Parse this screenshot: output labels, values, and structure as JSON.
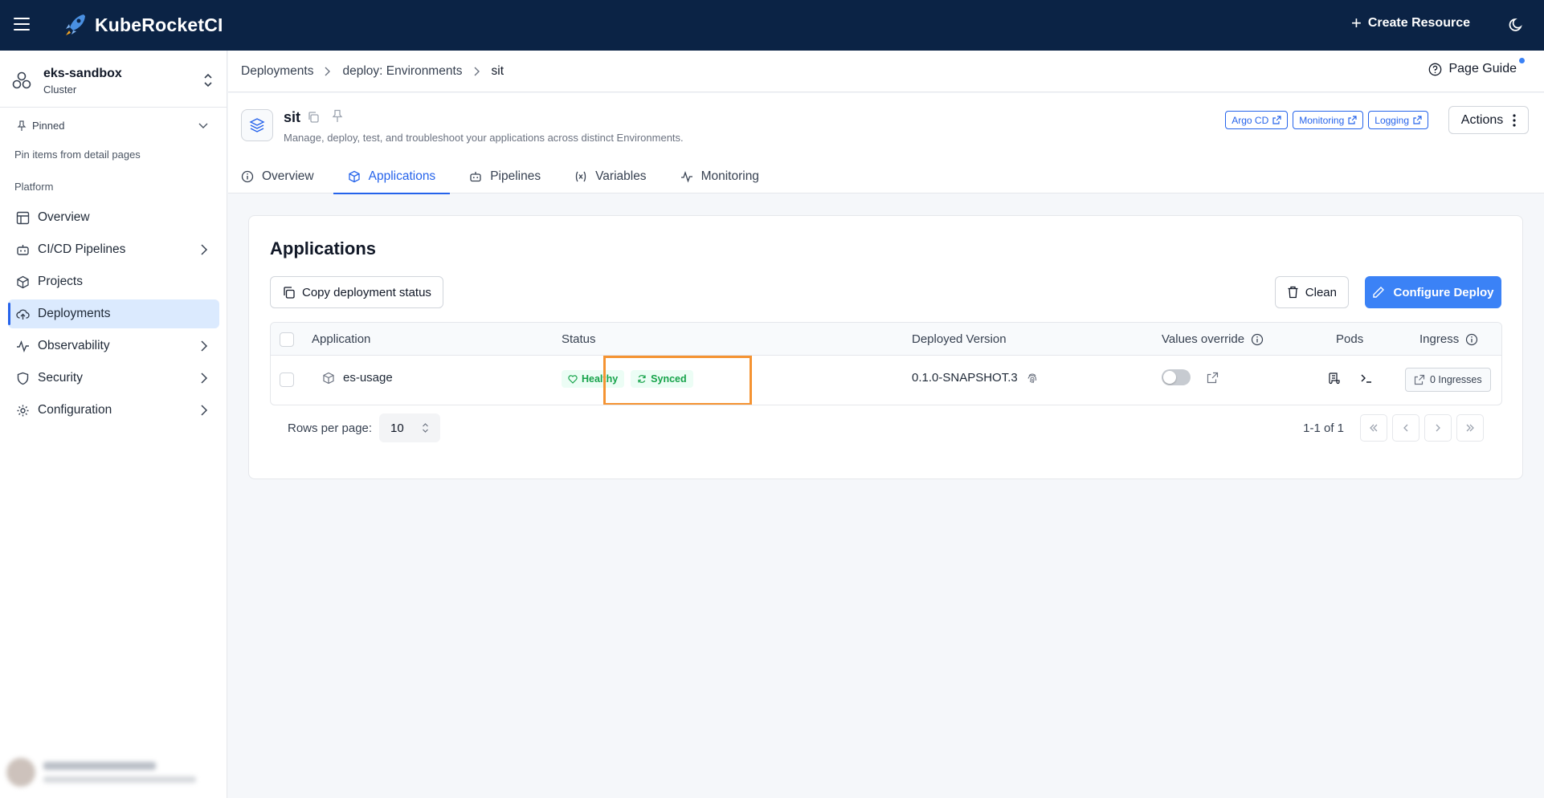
{
  "app": {
    "name": "KubeRocketCI"
  },
  "topbar": {
    "create_label": "Create Resource"
  },
  "sidebar": {
    "cluster": {
      "name": "eks-sandbox",
      "sub": "Cluster"
    },
    "pinned_label": "Pinned",
    "pinned_hint": "Pin items from detail pages",
    "section_label": "Platform",
    "items": [
      {
        "label": "Overview"
      },
      {
        "label": "CI/CD Pipelines"
      },
      {
        "label": "Projects"
      },
      {
        "label": "Deployments"
      },
      {
        "label": "Observability"
      },
      {
        "label": "Security"
      },
      {
        "label": "Configuration"
      }
    ]
  },
  "breadcrumb": {
    "items": [
      "Deployments",
      "deploy: Environments",
      "sit"
    ]
  },
  "page_guide_label": "Page Guide",
  "environment": {
    "title": "sit",
    "description": "Manage, deploy, test, and troubleshoot your applications across distinct Environments.",
    "links": [
      "Argo CD",
      "Monitoring",
      "Logging"
    ],
    "actions_label": "Actions"
  },
  "tabs": [
    "Overview",
    "Applications",
    "Pipelines",
    "Variables",
    "Monitoring"
  ],
  "card": {
    "title": "Applications",
    "copy_label": "Copy deployment status",
    "clean_label": "Clean",
    "configure_label": "Configure Deploy"
  },
  "table": {
    "columns": [
      "Application",
      "Status",
      "Deployed Version",
      "Values override",
      "Pods",
      "Ingress"
    ],
    "rows": [
      {
        "name": "es-usage",
        "health": "Healthy",
        "sync": "Synced",
        "version": "0.1.0-SNAPSHOT.3",
        "ingress": "0 Ingresses"
      }
    ]
  },
  "pagination": {
    "rows_label": "Rows per page:",
    "rows_value": "10",
    "range": "1-1 of 1"
  },
  "colors": {
    "topbar": "#0b2345",
    "accent": "#3b82f6",
    "success": "#16a34a",
    "highlight": "#f59332"
  }
}
